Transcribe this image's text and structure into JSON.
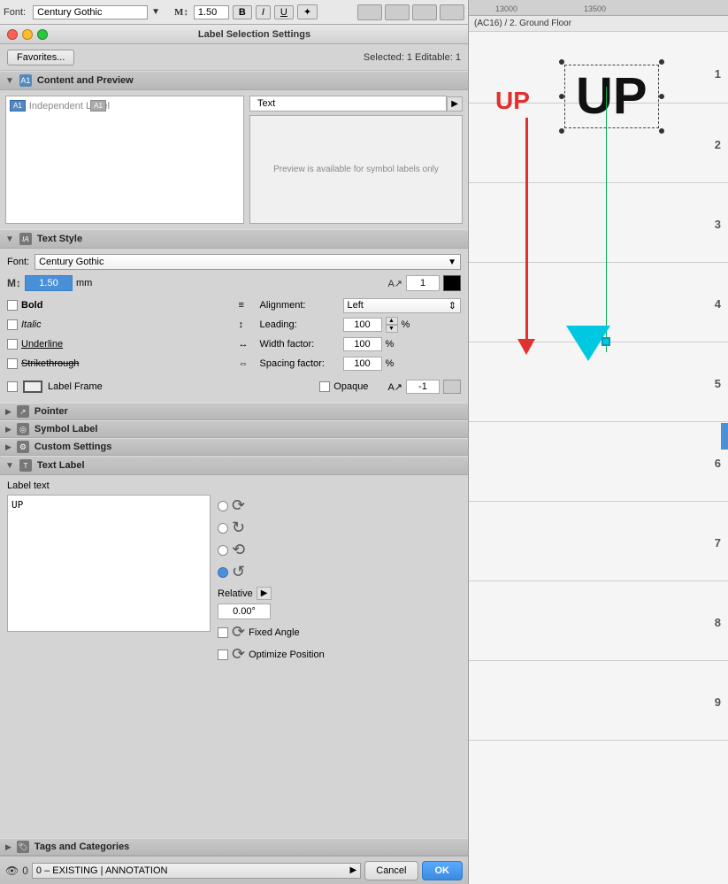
{
  "toolbar": {
    "font_label": "Font:",
    "font_name": "Century Gothic",
    "font_size": "1.50",
    "bold_label": "B",
    "italic_label": "I",
    "underline_label": "U",
    "special_label": "✦"
  },
  "window": {
    "title": "Label Selection Settings"
  },
  "favorites": {
    "btn_label": "Favorites...",
    "selected_info": "Selected: 1 Editable: 1"
  },
  "content_preview": {
    "section_title": "Content and Preview",
    "label_type": "Independent Label",
    "text_dropdown": "Text",
    "symbol_preview": "Preview is available for symbol labels only"
  },
  "text_style": {
    "section_title": "Text Style",
    "font_label": "Font:",
    "font_value": "Century Gothic",
    "size_value": "1.50",
    "size_unit": "mm",
    "angle_value": "1",
    "bold_label": "Bold",
    "italic_label": "Italic",
    "underline_label": "Underline",
    "strikethrough_label": "Strikethrough",
    "alignment_label": "Alignment:",
    "alignment_value": "Left",
    "leading_label": "Leading:",
    "leading_value": "100",
    "width_factor_label": "Width factor:",
    "width_factor_value": "100",
    "spacing_factor_label": "Spacing factor:",
    "spacing_factor_value": "100",
    "pct": "%",
    "label_frame_label": "Label Frame",
    "opaque_label": "Opaque",
    "minus_one_value": "-1"
  },
  "pointer": {
    "section_title": "Pointer"
  },
  "symbol_label": {
    "section_title": "Symbol Label"
  },
  "custom_settings": {
    "section_title": "Custom Settings"
  },
  "text_label_section": {
    "section_title": "Text Label",
    "label_text_title": "Label text",
    "text_content": "UP",
    "relative_label": "Relative",
    "angle_value": "0.00°",
    "fixed_angle_label": "Fixed Angle",
    "optimize_label": "Optimize Position"
  },
  "tags": {
    "section_title": "Tags and Categories"
  },
  "bottom_bar": {
    "annotation_label": "0 – EXISTING | ANNOTATION",
    "cancel_label": "Cancel",
    "ok_label": "OK"
  },
  "drawing": {
    "breadcrumb": "(AC16) / 2. Ground Floor",
    "ruler_labels": [
      "13000",
      "13500"
    ],
    "up_text_red": "UP",
    "up_text_main": "UP",
    "row_numbers": [
      "1",
      "2",
      "3",
      "4",
      "5",
      "6",
      "7",
      "8",
      "9"
    ]
  }
}
